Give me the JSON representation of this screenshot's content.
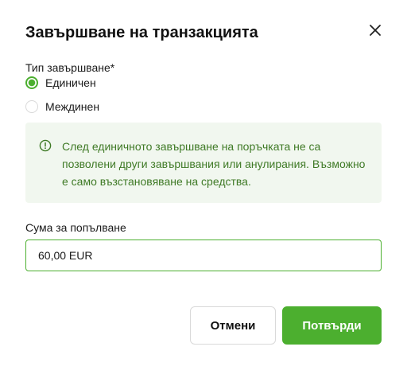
{
  "dialog": {
    "title": "Завършване на транзакцията",
    "close_icon": "close-icon"
  },
  "completion_type": {
    "label": "Тип завършване*",
    "options": [
      {
        "label": "Единичен",
        "selected": true
      },
      {
        "label": "Междинен",
        "selected": false
      }
    ]
  },
  "alert": {
    "icon": "info-circle-icon",
    "text": "След единичното завършване на поръчката не са позволени други завършвания или анулирания. Възможно е само възстановяване на средства."
  },
  "amount": {
    "label": "Сума за попълване",
    "value": "60,00 EUR"
  },
  "actions": {
    "cancel_label": "Отмени",
    "confirm_label": "Потвърди"
  },
  "colors": {
    "accent": "#4caf2f",
    "alert_bg": "#f1f7ef",
    "alert_text": "#3f7a26"
  }
}
